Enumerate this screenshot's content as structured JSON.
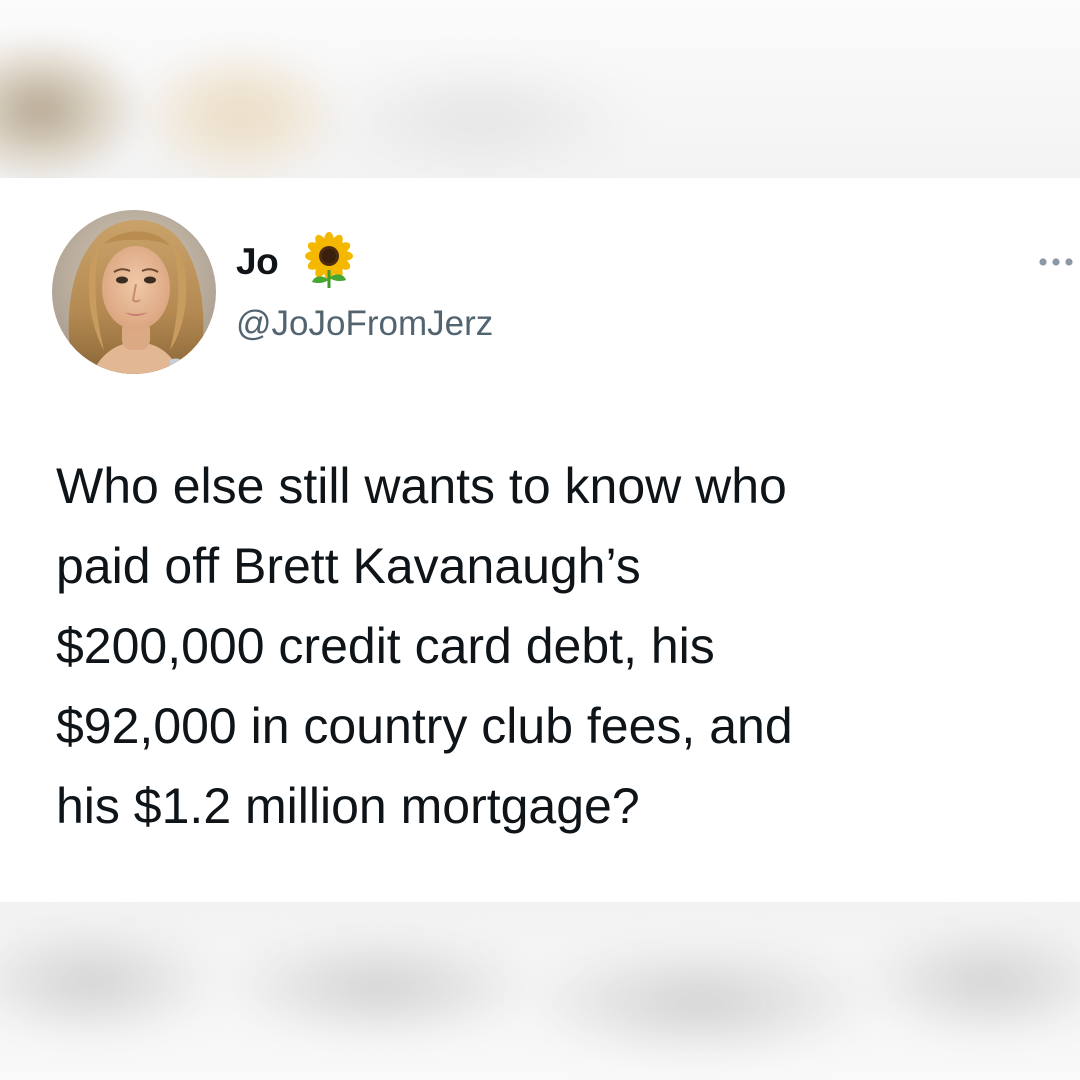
{
  "tweet": {
    "author": {
      "display_name": "Jo",
      "name_emoji": "sunflower-icon",
      "handle": "@JoJoFromJerz",
      "avatar": "profile-photo"
    },
    "text": "Who else still wants to know who\npaid off Brett Kavanaugh’s\n$200,000 credit card debt, his\n$92,000 in country club fees, and\nhis $1.2 million mortgage?",
    "more_menu_icon": "more-dots-icon"
  },
  "colors": {
    "text_primary": "#0f1419",
    "text_secondary": "#536471",
    "background": "#ffffff",
    "menu_dots": "#8b98a5"
  }
}
